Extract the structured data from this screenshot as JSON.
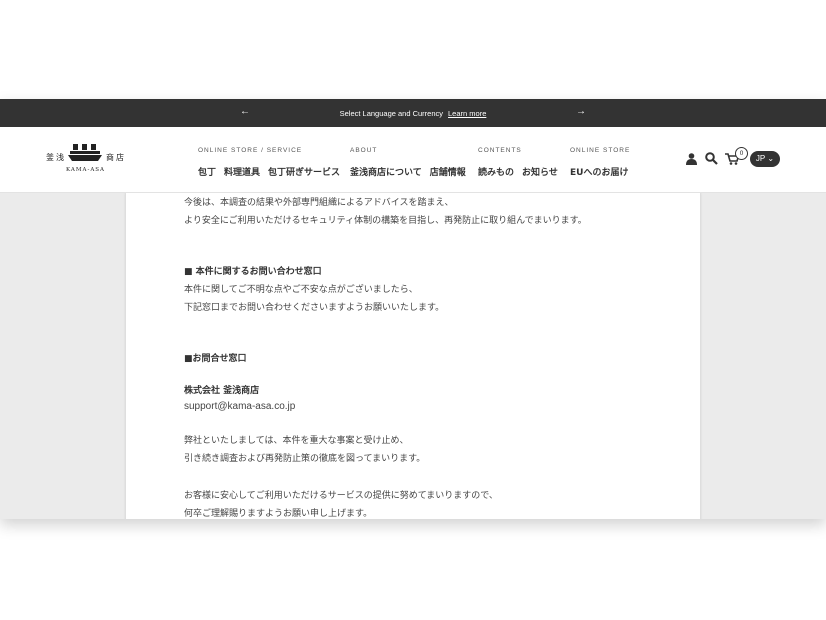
{
  "announcement": {
    "text": "Select Language and Currency",
    "link": "Learn more",
    "prev_arrow": "←",
    "next_arrow": "→"
  },
  "logo": {
    "jp_left": "釜浅",
    "jp_right": "商店",
    "en": "KAMA-ASA"
  },
  "nav": [
    {
      "category": "ONLINE STORE / SERVICE",
      "items": [
        "包丁",
        "料理道具",
        "包丁研ぎサービス"
      ]
    },
    {
      "category": "ABOUT",
      "items": [
        "釜浅商店について",
        "店舗情報"
      ]
    },
    {
      "category": "CONTENTS",
      "items": [
        "読みもの",
        "お知らせ"
      ]
    },
    {
      "category": "ONLINE STORE",
      "items": [
        "EUへのお届け"
      ]
    }
  ],
  "header_icons": {
    "account": "account-icon",
    "search": "search-icon",
    "cart": "cart-icon",
    "cart_count": "0",
    "language": "JP"
  },
  "article": {
    "lines": [
      "今後は、本調査の結果や外部専門組織によるアドバイスを踏まえ、",
      "より安全にご利用いただけるセキュリティ体制の構築を目指し、再発防止に取り組んでまいります。",
      "■ 本件に関するお問い合わせ窓口",
      "本件に関してご不明な点やご不安な点がございましたら、",
      "下記窓口までお問い合わせくださいますようお願いいたします。",
      "■お問合せ窓口",
      "株式会社 釜浅商店",
      "support@kama-asa.co.jp",
      "弊社といたしましては、本件を重大な事案と受け止め、",
      "引き続き調査および再発防止策の徹底を図ってまいります。",
      "お客様に安心してご利用いただけるサービスの提供に努めてまいりますので、",
      "何卒ご理解賜りますようお願い申し上げます。"
    ]
  }
}
